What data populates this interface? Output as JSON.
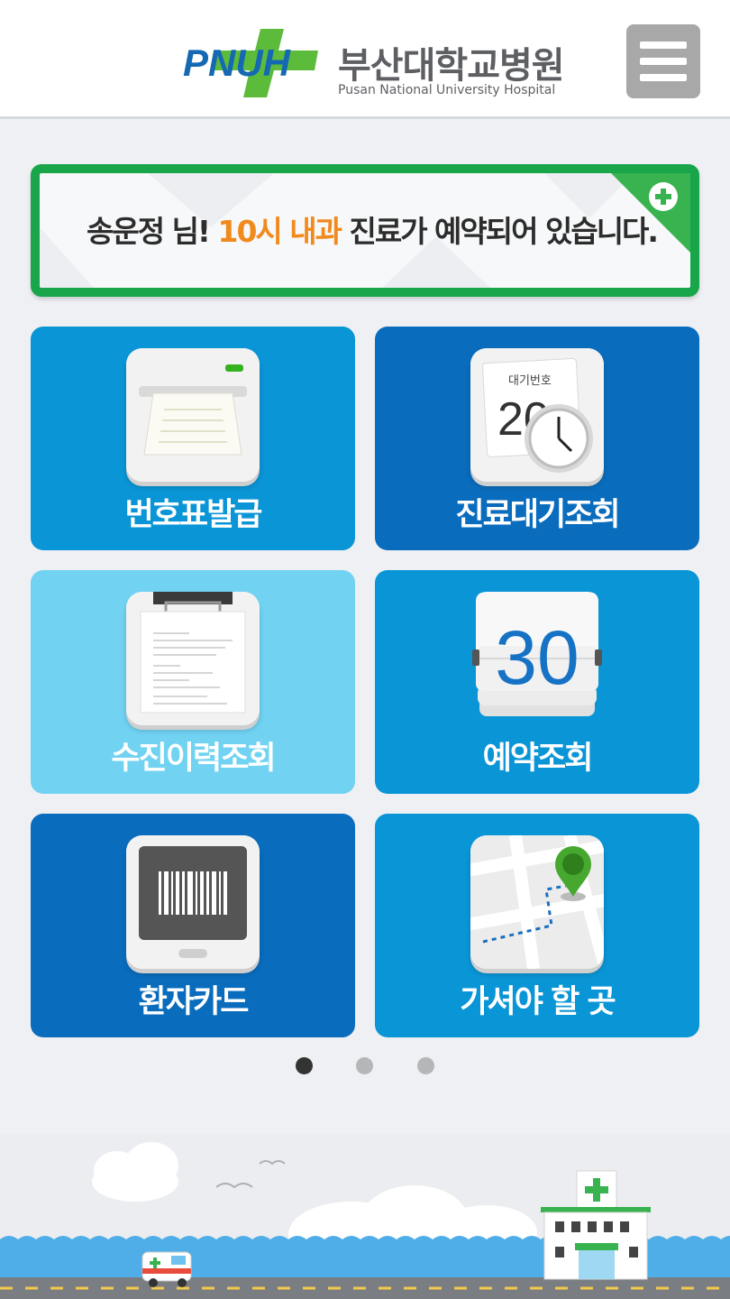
{
  "header": {
    "logo_text": "PNUH",
    "hospital_name_kr": "부산대학교병원",
    "hospital_name_en": "Pusan National University Hospital",
    "menu_icon": "hamburger-menu-icon"
  },
  "notice": {
    "name": "송운정 님!",
    "highlight": "10시 내과",
    "rest": "진료가 예약되어 있습니다.",
    "corner_icon": "plus-icon"
  },
  "tiles": [
    {
      "label": "번호표발급",
      "icon": "ticket-printer-icon",
      "color": "#0a95d6"
    },
    {
      "label": "진료대기조회",
      "icon": "waiting-number-clock-icon",
      "color": "#0a6cbd",
      "icon_text": "대기번호",
      "icon_number": "20"
    },
    {
      "label": "수진이력조회",
      "icon": "clipboard-icon",
      "color": "#71d2f2"
    },
    {
      "label": "예약조회",
      "icon": "flip-calendar-icon",
      "color": "#0a95d6",
      "icon_number": "30"
    },
    {
      "label": "환자카드",
      "icon": "barcode-card-icon",
      "color": "#0a6cbd"
    },
    {
      "label": "가셔야 할 곳",
      "icon": "map-pin-icon",
      "color": "#0a95d6"
    }
  ],
  "pager": {
    "pages": 3,
    "active": 1
  }
}
